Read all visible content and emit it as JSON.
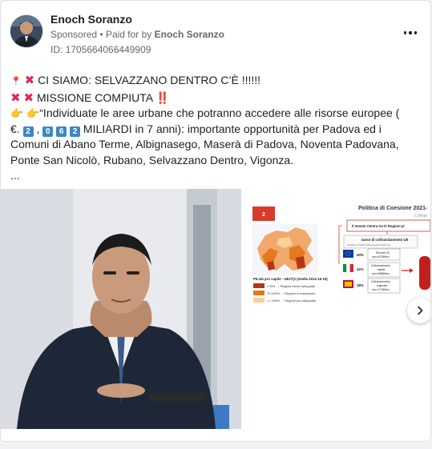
{
  "post": {
    "author": "Enoch Soranzo",
    "sponsored": "Sponsored",
    "separator": "•",
    "paid_for_prefix": "Paid for by",
    "paid_for_name": "Enoch Soranzo",
    "library_id": "ID: 1705664066449909"
  },
  "body": {
    "line1": "CI SIAMO: SELVAZZANO DENTRO C’È !!!!!!",
    "line2": "MISSIONE COMPIUTA ‼️",
    "line3": "“Individuate le aree urbane che potranno accedere alle risorse europee (",
    "line4_prefix": "€.",
    "line4_comma": ",",
    "line4_suffix": "MILIARDI in 7 anni): importante opportunità per Padova ed i",
    "line5": "Comuni di Abano Terme, Albignasego, Maserà di Padova, Noventa Padovana,",
    "line6": "Ponte San Nicolò, Rubano, Selvazzano Dentro, Vigonza.",
    "ellipsis": "...",
    "digits": [
      "2",
      "0",
      "6",
      "2"
    ]
  },
  "slide2": {
    "badge": "2",
    "title": "Politica di Coesione 2021-",
    "subtitle": "Cofinar",
    "veneto_text": "Il Veneto rientra tra le Regioni pi",
    "cofin_title": "tasso di cofinanziamento UE",
    "cofin_sub": "(rispetto al 100% della programmazione)",
    "eu_pct": "40%",
    "eu_label1": "Risorse UE",
    "eu_label2": "euro 627Milioni",
    "it_pct": "42%",
    "it_label1": "Cofinanziamento",
    "it_label2": "statale",
    "it_label3": "euro 658Milioni",
    "reg_pct": "18%",
    "reg_label1": "Cofinanziamento",
    "reg_label2": "regionale",
    "reg_label3": "euro 271Milioni",
    "legend_title": "PIL/ab pro capite - UE27(2 (media 2014-15-16)",
    "legend1": "<75% → Regioni meno sviluppate",
    "legend2": "75-100% → Regioni in transizione",
    "legend3": ">= 100% → Regioni più sviluppate"
  },
  "colors": {
    "accent_red": "#e0245e",
    "keycap_blue": "#3b88c3",
    "meta_gray": "#65676b"
  },
  "icons": [
    "more-options-icon",
    "pin-icon",
    "cross-mark-icon",
    "pointing-hand-icon",
    "chevron-right-icon"
  ]
}
